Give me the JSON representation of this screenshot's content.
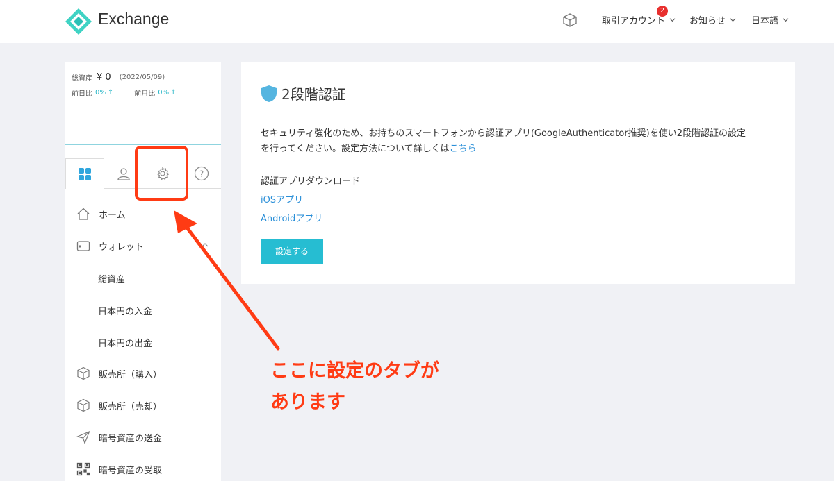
{
  "header": {
    "brand": "Exchange",
    "account_menu": "取引アカウント",
    "account_badge": "2",
    "news_menu": "お知らせ",
    "language_menu": "日本語"
  },
  "sidebar": {
    "assets": {
      "total_label": "総資産",
      "total_value": "¥ 0",
      "date": "(2022/05/09)",
      "daily_label": "前日比",
      "daily_value": "0%",
      "monthly_label": "前月比",
      "monthly_value": "0%"
    },
    "tabs": [
      {
        "icon": "grid-icon",
        "active": true
      },
      {
        "icon": "user-icon",
        "active": false
      },
      {
        "icon": "gear-icon",
        "active": false
      },
      {
        "icon": "help-icon",
        "active": false
      }
    ],
    "nav": {
      "home": "ホーム",
      "wallet": "ウォレット",
      "total_assets": "総資産",
      "jpy_deposit": "日本円の入金",
      "jpy_withdraw": "日本円の出金",
      "buy": "販売所（購入）",
      "sell": "販売所（売却）",
      "crypto_send": "暗号資産の送金",
      "crypto_receive": "暗号資産の受取"
    }
  },
  "annotation": {
    "line1": "ここに設定のタブが",
    "line2": "あります"
  },
  "main": {
    "title": "2段階認証",
    "desc_line1": "セキュリティ強化のため、お持ちのスマートフォンから認証アプリ(GoogleAuthenticator推奨)を使い2段階認証の設定",
    "desc_line2": "を行ってください。設定方法について詳しくは",
    "desc_link": "こちら",
    "download_heading": "認証アプリダウンロード",
    "ios_link": "iOSアプリ",
    "android_link": "Androidアプリ",
    "setup_button": "設定する"
  },
  "colors": {
    "accent": "#26bdd2",
    "link": "#2a8fd8",
    "annotation": "#ff3b14",
    "badge": "#e8302e",
    "tab_active": "#2fa6dd"
  }
}
